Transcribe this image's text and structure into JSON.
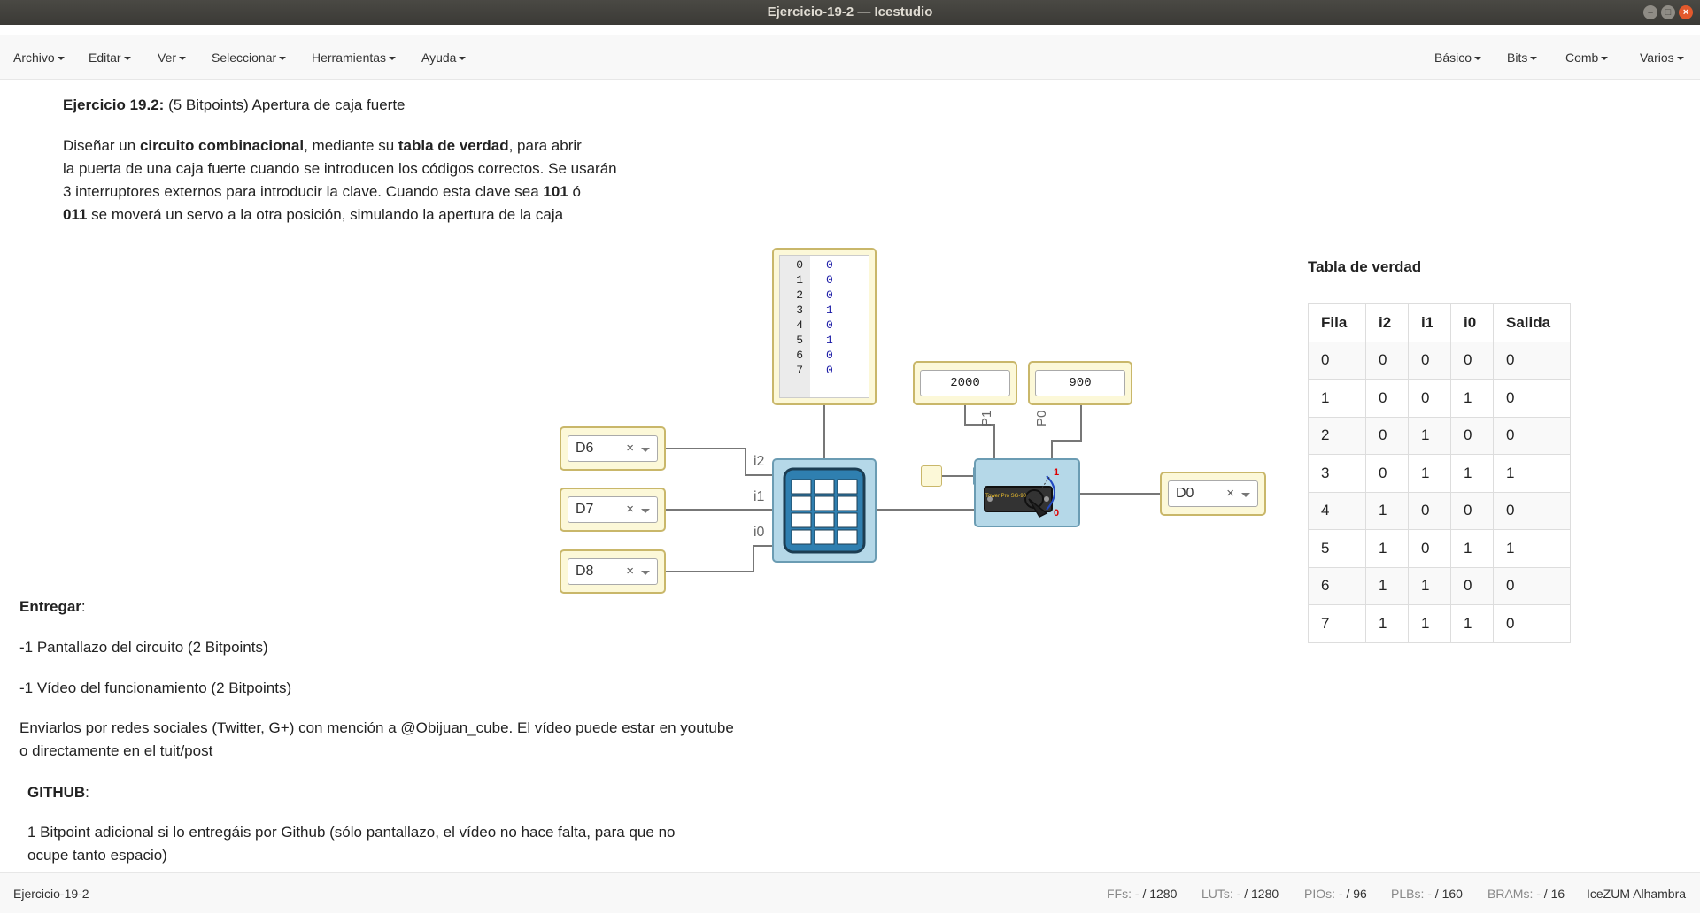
{
  "window": {
    "title": "Ejercicio-19-2 — Icestudio"
  },
  "menu_left": [
    {
      "label": "Archivo"
    },
    {
      "label": "Editar"
    },
    {
      "label": "Ver"
    },
    {
      "label": "Seleccionar"
    },
    {
      "label": "Herramientas"
    },
    {
      "label": "Ayuda"
    }
  ],
  "menu_right": [
    {
      "label": "Básico"
    },
    {
      "label": "Bits"
    },
    {
      "label": "Comb"
    },
    {
      "label": "Varios"
    }
  ],
  "exercise": {
    "heading_bold": "Ejercicio 19.2:",
    "heading_rest": " (5 Bitpoints) Apertura de caja fuerte",
    "p1_a": "Diseñar un ",
    "p1_b": "circuito combinacional",
    "p1_c": ", mediante su ",
    "p1_d": "tabla de verdad",
    "p1_e": ", para abrir",
    "p2": "la puerta de una caja fuerte cuando se introducen los códigos correctos. Se usarán",
    "p3_a": "3 interruptores externos para introducir la clave. Cuando esta clave sea ",
    "p3_b": "101",
    "p3_c": " ó",
    "p4_a": "011",
    "p4_b": " se moverá un servo a la otra posición, simulando la apertura de la caja"
  },
  "deliver": {
    "title": "Entregar",
    "colon": ":",
    "item1": "-1 Pantallazo del circuito (2 Bitpoints)",
    "item2": "-1 Vídeo del funcionamiento (2 Bitpoints)",
    "social1": "Enviarlos por redes sociales (Twitter, G+) con mención a @Obijuan_cube. El vídeo puede estar en youtube",
    "social2": "o directamente en el tuit/post",
    "github_title": "GITHUB",
    "github1": "1 Bitpoint adicional si lo entregáis por Github (sólo pantallazo, el vídeo no hace falta, para que no",
    "github2": "ocupe tanto espacio)"
  },
  "circuit": {
    "inputs": [
      {
        "pin": "D6",
        "port": "i2"
      },
      {
        "pin": "D7",
        "port": "i1"
      },
      {
        "pin": "D8",
        "port": "i0"
      }
    ],
    "output": {
      "pin": "D0"
    },
    "clear_symbol": "×",
    "memory": [
      {
        "line": "0",
        "value": "0"
      },
      {
        "line": "1",
        "value": "0"
      },
      {
        "line": "2",
        "value": "0"
      },
      {
        "line": "3",
        "value": "1"
      },
      {
        "line": "4",
        "value": "0"
      },
      {
        "line": "5",
        "value": "1"
      },
      {
        "line": "6",
        "value": "0"
      },
      {
        "line": "7",
        "value": "0"
      }
    ],
    "const_p1": "2000",
    "const_p0": "900",
    "param_p1": "P1",
    "param_p0": "P0",
    "servo_top_mark": "1",
    "servo_bottom_mark": "0",
    "servo_label": "Tower Pro SG-90"
  },
  "truth_table": {
    "title": "Tabla de verdad",
    "headers": [
      "Fila",
      "i2",
      "i1",
      "i0",
      "Salida"
    ],
    "rows": [
      [
        "0",
        "0",
        "0",
        "0",
        "0"
      ],
      [
        "1",
        "0",
        "0",
        "1",
        "0"
      ],
      [
        "2",
        "0",
        "1",
        "0",
        "0"
      ],
      [
        "3",
        "0",
        "1",
        "1",
        "1"
      ],
      [
        "4",
        "1",
        "0",
        "0",
        "0"
      ],
      [
        "5",
        "1",
        "0",
        "1",
        "1"
      ],
      [
        "6",
        "1",
        "1",
        "0",
        "0"
      ],
      [
        "7",
        "1",
        "1",
        "1",
        "0"
      ]
    ]
  },
  "status": {
    "project": "Ejercicio-19-2",
    "ffs_label": "FFs:",
    "ffs_value": "- / 1280",
    "luts_label": "LUTs:",
    "luts_value": "- / 1280",
    "pios_label": "PIOs:",
    "pios_value": "- / 96",
    "plbs_label": "PLBs:",
    "plbs_value": "- / 160",
    "brams_label": "BRAMs:",
    "brams_value": "- / 16",
    "board": "IceZUM Alhambra"
  },
  "colors": {
    "titlebar": "#3b3a36",
    "io_fill": "#fcf8d8",
    "module_fill": "#b5d8e8",
    "close": "#e3592c"
  }
}
